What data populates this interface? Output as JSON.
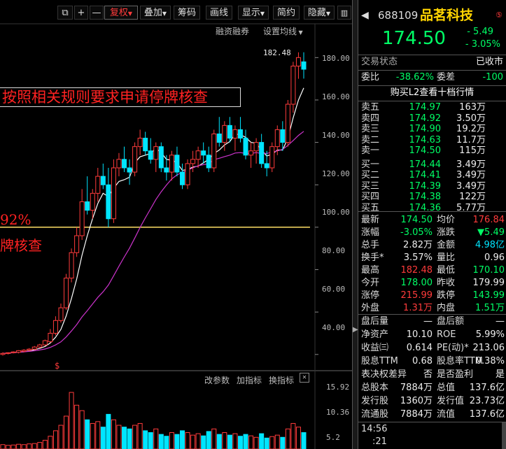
{
  "toolbar": {
    "buttons": [
      {
        "label": "+"
      },
      {
        "label": "—"
      },
      {
        "label": "复权"
      },
      {
        "label": "叠加"
      },
      {
        "label": "筹码"
      },
      {
        "label": "画线"
      },
      {
        "label": "显示"
      },
      {
        "label": "简约"
      },
      {
        "label": "隐藏"
      }
    ],
    "sub_tools": [
      "融资融券",
      "设置均线"
    ]
  },
  "chart": {
    "banner": "按照相关规则要求申请停牌核查",
    "left_pct": "92%",
    "left_text": "牌核查",
    "high_marker": "182.48",
    "dividend_mark": "$",
    "price_ticks": [
      "180.00",
      "160.00",
      "140.00",
      "120.00",
      "100.00",
      "80.00",
      "60.00",
      "40.00"
    ],
    "volume_ticks": [
      "15.92",
      "10.36",
      "5.2"
    ],
    "volume_tools": [
      "改参数",
      "加指标",
      "换指标"
    ]
  },
  "quote": {
    "code": "688109",
    "name": "品茗科技",
    "price": "174.50",
    "change": "- 5.49",
    "change_pct": "- 3.05%",
    "status_label": "交易状态",
    "status_value": "已收市",
    "weibi_label": "委比",
    "weibi_value": "-38.62%",
    "weicha_label": "委差",
    "weicha_value": "-100",
    "l2_link": "购买L2查看十档行情",
    "sells": [
      {
        "label": "卖五",
        "price": "174.97",
        "vol": "163万"
      },
      {
        "label": "卖四",
        "price": "174.92",
        "vol": "3.50万"
      },
      {
        "label": "卖三",
        "price": "174.90",
        "vol": "19.2万"
      },
      {
        "label": "卖二",
        "price": "174.63",
        "vol": "11.7万"
      },
      {
        "label": "卖一",
        "price": "174.50",
        "vol": "115万"
      }
    ],
    "buys": [
      {
        "label": "买一",
        "price": "174.44",
        "vol": "3.49万"
      },
      {
        "label": "买二",
        "price": "174.41",
        "vol": "3.49万"
      },
      {
        "label": "买三",
        "price": "174.39",
        "vol": "3.49万"
      },
      {
        "label": "买四",
        "price": "174.38",
        "vol": "122万"
      },
      {
        "label": "买五",
        "price": "174.36",
        "vol": "5.77万"
      }
    ],
    "stats": [
      {
        "l1": "最新",
        "v1": "174.50",
        "c1": "g",
        "l2": "均价",
        "v2": "176.84",
        "c2": "r"
      },
      {
        "l1": "涨幅",
        "v1": "-3.05%",
        "c1": "g",
        "l2": "涨跌",
        "v2": "▼5.49",
        "c2": "g"
      },
      {
        "l1": "总手",
        "v1": "2.82万",
        "c1": "w",
        "l2": "金额",
        "v2": "4.98亿",
        "c2": "c"
      },
      {
        "l1": "换手*",
        "v1": "3.57%",
        "c1": "w",
        "l2": "量比",
        "v2": "0.96",
        "c2": "w"
      },
      {
        "l1": "最高",
        "v1": "182.48",
        "c1": "r",
        "l2": "最低",
        "v2": "170.10",
        "c2": "g"
      },
      {
        "l1": "今开",
        "v1": "178.00",
        "c1": "g",
        "l2": "昨收",
        "v2": "179.99",
        "c2": "w"
      },
      {
        "l1": "涨停",
        "v1": "215.99",
        "c1": "r",
        "l2": "跌停",
        "v2": "143.99",
        "c2": "g"
      },
      {
        "l1": "外盘",
        "v1": "1.31万",
        "c1": "r",
        "l2": "内盘",
        "v2": "1.51万",
        "c2": "g"
      }
    ],
    "fund": [
      {
        "l1": "盘后量",
        "v1": "—",
        "l2": "盘后额",
        "v2": "—"
      },
      {
        "l1": "净资产",
        "v1": "10.10",
        "l2": "ROE",
        "v2": "5.99%"
      },
      {
        "l1": "收益㈢",
        "v1": "0.614",
        "l2": "PE(动)*",
        "v2": "213.06"
      },
      {
        "l1": "股息TTM",
        "v1": "0.68",
        "l2": "股息率TTM",
        "v2": "0.38%"
      },
      {
        "l1": "表决权差异",
        "v1": "否",
        "l2": "是否盈利",
        "v2": "是"
      },
      {
        "l1": "总股本",
        "v1": "7884万",
        "l2": "总值",
        "v2": "137.6亿"
      },
      {
        "l1": "发行股",
        "v1": "1360万",
        "l2": "发行值",
        "v2": "23.73亿"
      },
      {
        "l1": "流通股",
        "v1": "7884万",
        "l2": "流值",
        "v2": "137.6亿"
      }
    ],
    "tick_time": "14:56",
    "tick_time2": ":21"
  },
  "chart_data": {
    "type": "candlestick",
    "price_ylim": [
      34,
      190
    ],
    "volume_ylim": [
      0,
      18
    ],
    "candles": [
      [
        40,
        41,
        39.5,
        40.5
      ],
      [
        40.5,
        41,
        40,
        40.8
      ],
      [
        40.8,
        41.5,
        40.5,
        41.2
      ],
      [
        41,
        42,
        40.5,
        41.8
      ],
      [
        41.5,
        42.5,
        41,
        42
      ],
      [
        42,
        43,
        41.5,
        42.5
      ],
      [
        42.5,
        44,
        42,
        43.5
      ],
      [
        43.5,
        45,
        43,
        44.5
      ],
      [
        44.5,
        47,
        44,
        46.5
      ],
      [
        46,
        52,
        45.5,
        50
      ],
      [
        50,
        58,
        49,
        56
      ],
      [
        56,
        64,
        55,
        62
      ],
      [
        62,
        78,
        61,
        76
      ],
      [
        76,
        90,
        74,
        88
      ],
      [
        88,
        100,
        86,
        96
      ],
      [
        96,
        118,
        94,
        112
      ],
      [
        112,
        124,
        106,
        108
      ],
      [
        108,
        118,
        104,
        116
      ],
      [
        116,
        128,
        112,
        124
      ],
      [
        124,
        130,
        118,
        120
      ],
      [
        120,
        128,
        100,
        104
      ],
      [
        104,
        132,
        102,
        128
      ],
      [
        128,
        135,
        124,
        132
      ],
      [
        132,
        138,
        126,
        128
      ],
      [
        128,
        132,
        120,
        126
      ],
      [
        126,
        140,
        124,
        138
      ],
      [
        138,
        146,
        134,
        142
      ],
      [
        142,
        145,
        134,
        136
      ],
      [
        136,
        142,
        130,
        132
      ],
      [
        132,
        140,
        126,
        138
      ],
      [
        138,
        140,
        126,
        128
      ],
      [
        128,
        134,
        122,
        126
      ],
      [
        126,
        136,
        122,
        134
      ],
      [
        134,
        138,
        124,
        126
      ],
      [
        126,
        130,
        118,
        120
      ],
      [
        120,
        132,
        118,
        130
      ],
      [
        130,
        136,
        126,
        132
      ],
      [
        132,
        138,
        128,
        136
      ],
      [
        136,
        140,
        130,
        134
      ],
      [
        134,
        138,
        126,
        128
      ],
      [
        128,
        146,
        126,
        144
      ],
      [
        144,
        152,
        138,
        140
      ],
      [
        140,
        150,
        136,
        148
      ],
      [
        148,
        152,
        140,
        142
      ],
      [
        142,
        148,
        136,
        146
      ],
      [
        146,
        152,
        140,
        142
      ],
      [
        142,
        146,
        132,
        134
      ],
      [
        134,
        140,
        128,
        136
      ],
      [
        136,
        142,
        130,
        140
      ],
      [
        140,
        144,
        128,
        130
      ],
      [
        130,
        136,
        124,
        128
      ],
      [
        128,
        140,
        126,
        138
      ],
      [
        138,
        148,
        134,
        146
      ],
      [
        146,
        150,
        136,
        140
      ],
      [
        140,
        160,
        138,
        158
      ],
      [
        158,
        178,
        154,
        176
      ],
      [
        176,
        182.48,
        170,
        180
      ],
      [
        178,
        182.48,
        170.1,
        174.5
      ]
    ],
    "volumes": [
      1.2,
      1.0,
      1.1,
      1.3,
      1.2,
      1.4,
      1.5,
      1.8,
      2.4,
      3.5,
      5.0,
      6.5,
      9.0,
      15.5,
      12.0,
      10.5,
      8.0,
      7.0,
      7.5,
      6.0,
      9.5,
      8.0,
      6.5,
      6.0,
      5.5,
      6.5,
      7.0,
      5.0,
      4.5,
      5.5,
      4.0,
      3.5,
      4.5,
      4.0,
      5.0,
      4.5,
      3.8,
      4.2,
      3.6,
      4.8,
      5.5,
      4.0,
      4.5,
      3.8,
      4.2,
      3.5,
      4.0,
      3.6,
      3.2,
      4.2,
      3.0,
      3.4,
      3.8,
      3.2,
      5.5,
      7.0,
      6.0,
      4.5
    ]
  }
}
